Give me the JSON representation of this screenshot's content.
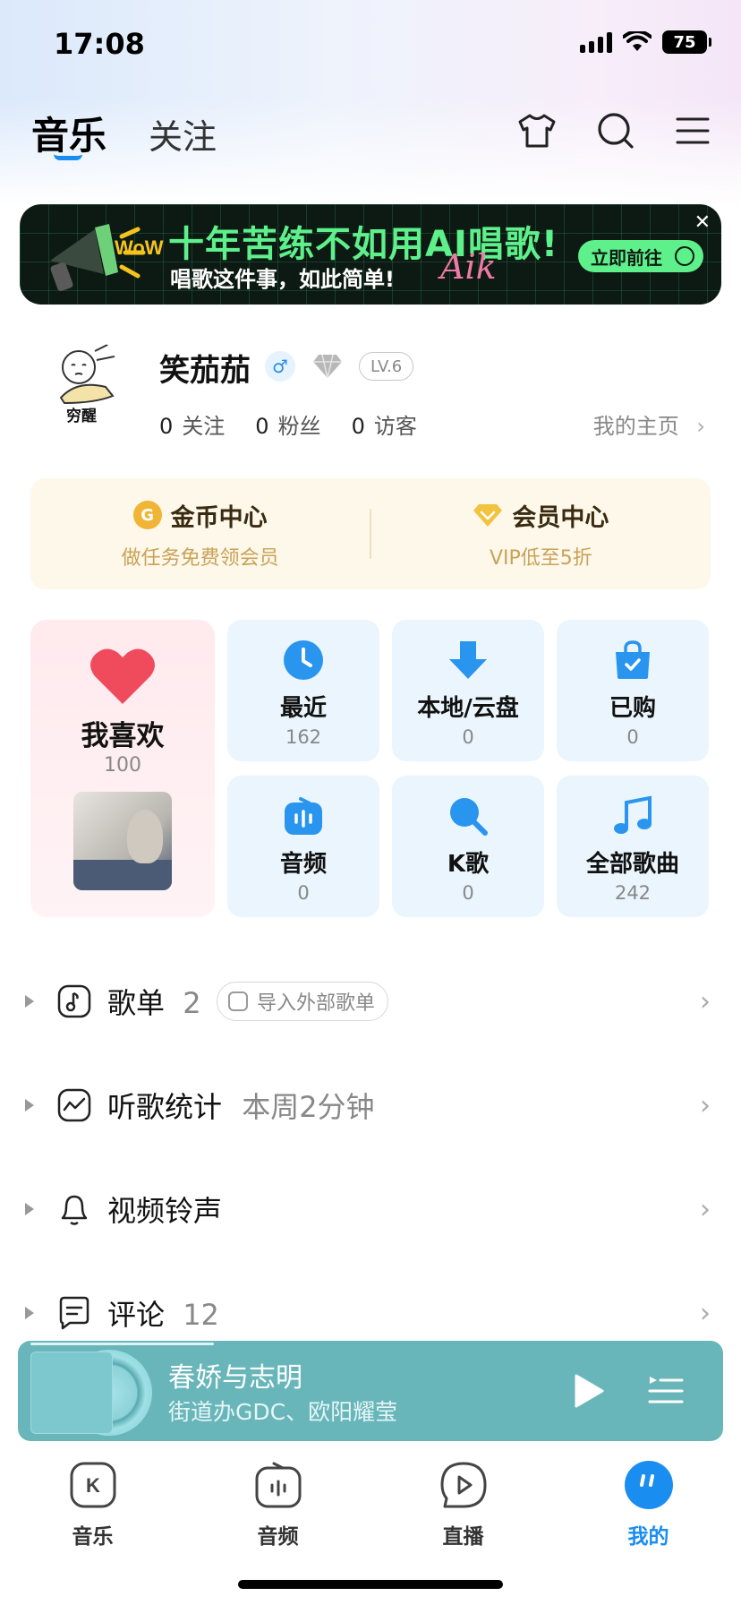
{
  "status_bar": {
    "time": "17:08",
    "battery": "75"
  },
  "top_nav": {
    "tab_music": "音乐",
    "tab_follow": "关注"
  },
  "banner": {
    "title": "十年苦练不如用AI唱歌!",
    "subtitle": "唱歌这件事，如此简单!",
    "cta": "立即前往",
    "decor_text": "WoW",
    "script_text": "Aik"
  },
  "profile": {
    "avatar_text": "穷醒",
    "username": "笑茄茄",
    "level": "LV.6",
    "follow_count": "0",
    "follow_label": "关注",
    "fans_count": "0",
    "fans_label": "粉丝",
    "visitors_count": "0",
    "visitors_label": "访客",
    "homepage_label": "我的主页"
  },
  "benefits": {
    "coin_title": "金币中心",
    "coin_sub": "做任务免费领会员",
    "vip_title": "会员中心",
    "vip_sub": "VIP低至5折"
  },
  "tiles": {
    "favorites": {
      "label": "我喜欢",
      "count": "100"
    },
    "recent": {
      "label": "最近",
      "count": "162"
    },
    "local": {
      "label": "本地/云盘",
      "count": "0"
    },
    "purchased": {
      "label": "已购",
      "count": "0"
    },
    "audio": {
      "label": "音频",
      "count": "0"
    },
    "karaoke": {
      "label": "K歌",
      "count": "0"
    },
    "all_songs": {
      "label": "全部歌曲",
      "count": "242"
    }
  },
  "list": {
    "playlists_label": "歌单",
    "playlists_count": "2",
    "import_label": "导入外部歌单",
    "stats_label": "听歌统计",
    "stats_value": "本周2分钟",
    "ringtone_label": "视频铃声",
    "comments_label": "评论",
    "comments_count": "12"
  },
  "player": {
    "title": "春娇与志明",
    "artist": "街道办GDC、欧阳耀莹",
    "progress": 0.26
  },
  "tabbar": {
    "music": "音乐",
    "audio": "音频",
    "live": "直播",
    "mine": "我的",
    "active": "mine"
  },
  "colors": {
    "accent_blue": "#1a8df0",
    "player_bg": "#68b6ba",
    "banner_green": "#5ef08a",
    "tile_bg": "#eaf5fd",
    "fav_bg": "#ffeaee"
  }
}
